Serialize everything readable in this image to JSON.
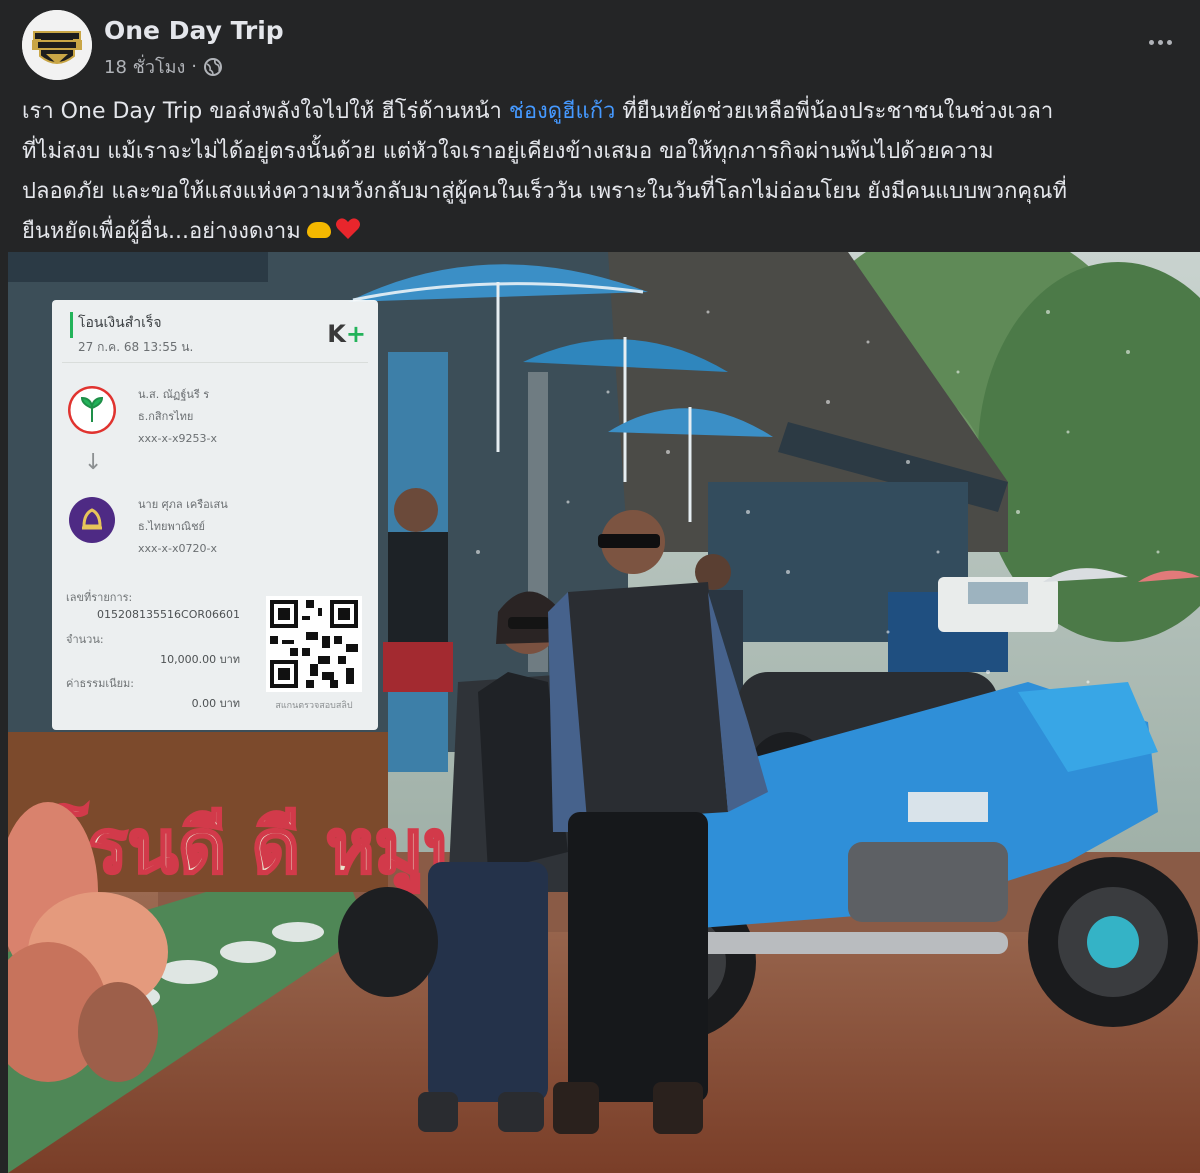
{
  "post": {
    "page_name": "One Day Trip",
    "time": "18 ชั่วโมง",
    "separator": "·",
    "privacy_icon": "globe-icon",
    "more_icon": "more-options-icon",
    "text": {
      "line1_a": "เรา One Day Trip ขอส่งพลังใจไปให้ ฮีโร่ด้านหน้า ",
      "hashtag": "ช่องดูฮีแก้ว",
      "line1_b": "  ที่ยืนหยัดช่วยเหลือพี่น้องประชาชนในช่วงเวลา",
      "line2": "ที่ไม่สงบ แม้เราจะไม่ได้อยู่ตรงนั้นด้วย แต่หัวใจเราอยู่เคียงข้างเสมอ ขอให้ทุกภารกิจผ่านพ้นไปด้วยความ",
      "line3": "ปลอดภัย และขอให้แสงแห่งความหวังกลับมาสู่ผู้คนในเร็ววัน เพราะในวันที่โลกไม่อ่อนโยน ยังมีคนแบบพวกคุณที่",
      "line4": "ยืนหยัดเพื่อผู้อื่น...อย่างงดงาม",
      "emoji": [
        "handshake-emoji",
        "red-heart-emoji"
      ]
    }
  },
  "photo": {
    "shop_sign": "โรนดี ดี หมูป",
    "transfer_slip": {
      "title": "โอนเงินสำเร็จ",
      "datetime": "27 ก.ค. 68  13:55 น.",
      "brand": "K",
      "brand_plus": "+",
      "sender": {
        "name": "น.ส. ณัฏฐ์นรี ร",
        "bank": "ธ.กสิกรไทย",
        "account": "xxx-x-x9253-x"
      },
      "receiver": {
        "name": "นาย ศุภล เครือเสน",
        "bank": "ธ.ไทยพาณิชย์",
        "account": "xxx-x-x0720-x"
      },
      "ref_label": "เลขที่รายการ:",
      "ref_value": "015208135516COR06601",
      "amount_label": "จำนวน:",
      "amount_value": "10,000.00 บาท",
      "fee_label": "ค่าธรรมเนียม:",
      "fee_value": "0.00 บาท",
      "qr_caption": "สแกนตรวจสอบสลิป"
    },
    "colors": {
      "kbank_green": "#23b35a",
      "scb_purple": "#4e2a84",
      "bike_blue": "#2f8fd8",
      "umbrella_blue": "#3b8fc6"
    }
  }
}
